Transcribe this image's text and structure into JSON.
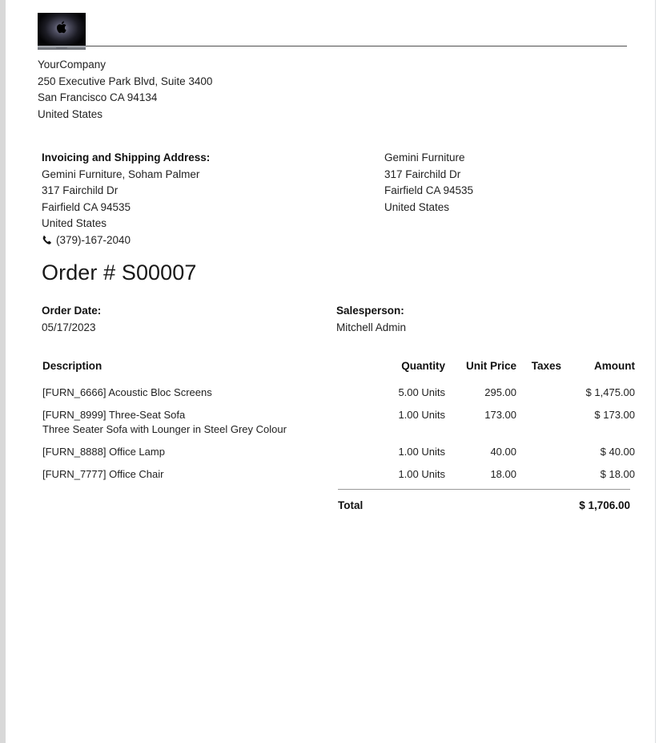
{
  "document": {
    "logo": {
      "icon": "apple-macbook-logo",
      "alt": "Company logo"
    },
    "company": {
      "name": "YourCompany",
      "street": "250 Executive Park Blvd, Suite 3400",
      "city_state_zip": "San Francisco CA 94134",
      "country": "United States"
    },
    "invoicing_address": {
      "title": "Invoicing and Shipping Address:",
      "line1": "Gemini Furniture, Soham Palmer",
      "line2": "317 Fairchild Dr",
      "line3": "Fairfield CA 94535",
      "line4": "United States",
      "phone": "(379)-167-2040",
      "phone_icon": "phone-icon"
    },
    "shipping_address": {
      "line1": "Gemini Furniture",
      "line2": "317 Fairchild Dr",
      "line3": "Fairfield CA 94535",
      "line4": "United States"
    },
    "title": "Order # S00007",
    "meta": {
      "order_date_label": "Order Date:",
      "order_date_value": "05/17/2023",
      "salesperson_label": "Salesperson:",
      "salesperson_value": "Mitchell Admin"
    },
    "table": {
      "headers": {
        "description": "Description",
        "quantity": "Quantity",
        "unit_price": "Unit Price",
        "taxes": "Taxes",
        "amount": "Amount"
      },
      "rows": [
        {
          "description": "[FURN_6666] Acoustic Bloc Screens",
          "subnote": "",
          "quantity": "5.00 Units",
          "unit_price": "295.00",
          "taxes": "",
          "amount": "$ 1,475.00"
        },
        {
          "description": "[FURN_8999] Three-Seat Sofa",
          "subnote": "Three Seater Sofa with Lounger in Steel Grey Colour",
          "quantity": "1.00 Units",
          "unit_price": "173.00",
          "taxes": "",
          "amount": "$ 173.00"
        },
        {
          "description": "[FURN_8888] Office Lamp",
          "subnote": "",
          "quantity": "1.00 Units",
          "unit_price": "40.00",
          "taxes": "",
          "amount": "$ 40.00"
        },
        {
          "description": "[FURN_7777] Office Chair",
          "subnote": "",
          "quantity": "1.00 Units",
          "unit_price": "18.00",
          "taxes": "",
          "amount": "$ 18.00"
        }
      ]
    },
    "totals": {
      "label": "Total",
      "value": "$ 1,706.00"
    }
  },
  "colors": {
    "page_background": "#ffffff",
    "text": "#1f1f1f",
    "heading": "#111111",
    "header_rule": "#4f4f4f",
    "totals_rule": "#9a9a9a",
    "gutter": "#d8d8d8"
  }
}
